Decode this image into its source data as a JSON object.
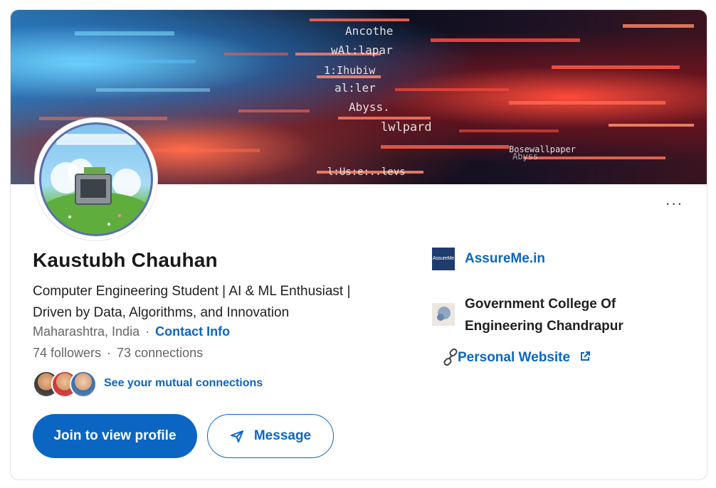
{
  "profile": {
    "name": "Kaustubh Chauhan",
    "headline_line1": "Computer Engineering Student | AI & ML Enthusiast |",
    "headline_line2": "Driven by Data, Algorithms, and Innovation",
    "location": "Maharashtra, India",
    "separator": "·",
    "contact_info_label": "Contact Info",
    "followers": "74 followers",
    "connections": "73 connections",
    "mutual_connections_label": "See your mutual connections"
  },
  "actions": {
    "join_label": "Join to view profile",
    "message_label": "Message",
    "more_label": "···"
  },
  "sidebar": {
    "company_logo_text": "AssureMe",
    "company": "AssureMe.in",
    "college_line1": "Government College Of",
    "college_line2": "Engineering Chandrapur",
    "website_label": "Personal Website"
  },
  "icons": {
    "more": "ellipsis-icon",
    "message": "send-icon",
    "website": "link-icon",
    "external": "external-link-icon"
  },
  "colors": {
    "accent": "#0a66c2",
    "company_logo_bg": "#1f3c6e"
  }
}
